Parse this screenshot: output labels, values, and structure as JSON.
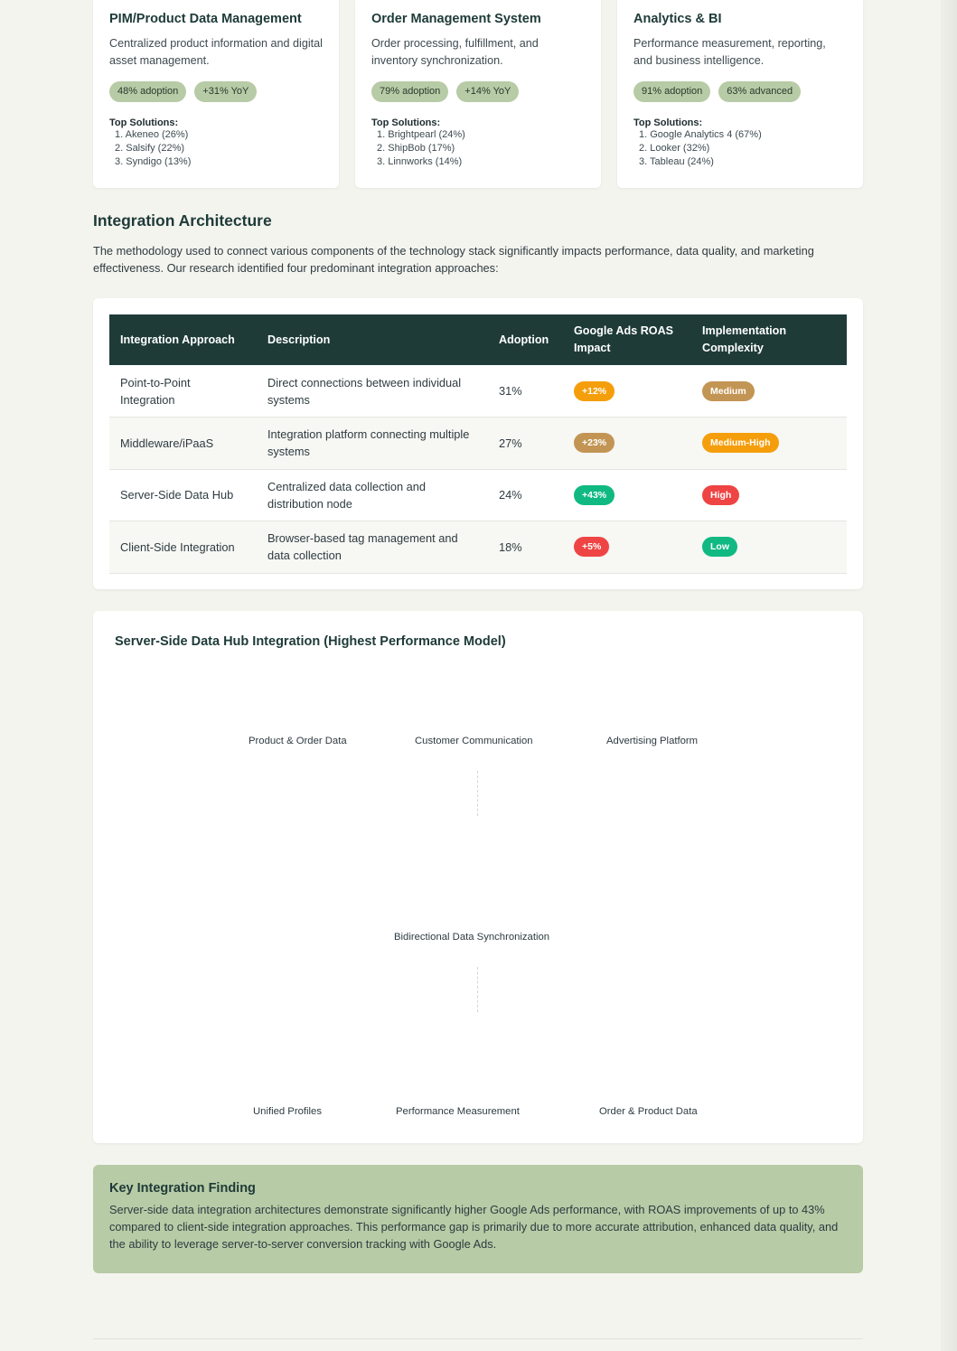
{
  "categories": [
    {
      "title": "PIM/Product Data Management",
      "description": "Centralized product information and digital asset management.",
      "pills": [
        "48% adoption",
        "+31% YoY"
      ],
      "solutions_title": "Top Solutions:",
      "solutions": [
        "1. Akeneo (26%)",
        "2. Salsify (22%)",
        "3. Syndigo (13%)"
      ]
    },
    {
      "title": "Order Management System",
      "description": "Order processing, fulfillment, and inventory synchronization.",
      "pills": [
        "79% adoption",
        "+14% YoY"
      ],
      "solutions_title": "Top Solutions:",
      "solutions": [
        "1. Brightpearl (24%)",
        "2. ShipBob (17%)",
        "3. Linnworks (14%)"
      ]
    },
    {
      "title": "Analytics & BI",
      "description": "Performance measurement, reporting, and business intelligence.",
      "pills": [
        "91% adoption",
        "63% advanced"
      ],
      "solutions_title": "Top Solutions:",
      "solutions": [
        "1. Google Analytics 4 (67%)",
        "2. Looker (32%)",
        "3. Tableau (24%)"
      ]
    }
  ],
  "integration": {
    "title": "Integration Architecture",
    "intro": "The methodology used to connect various components of the technology stack significantly impacts performance, data quality, and marketing effectiveness. Our research identified four predominant integration approaches:",
    "table": {
      "headers": [
        "Integration Approach",
        "Description",
        "Adoption",
        "Google Ads ROAS Impact",
        "Implementation Complexity"
      ],
      "rows": [
        {
          "approach": "Point-to-Point Integration",
          "description": "Direct connections between individual systems",
          "adoption": "31%",
          "roas": "+12%",
          "roas_color": "#f59e0b",
          "complexity": "Medium",
          "complexity_color": "#c39554"
        },
        {
          "approach": "Middleware/iPaaS",
          "description": "Integration platform connecting multiple systems",
          "adoption": "27%",
          "roas": "+23%",
          "roas_color": "#c39554",
          "complexity": "Medium-High",
          "complexity_color": "#f59e0b"
        },
        {
          "approach": "Server-Side Data Hub",
          "description": "Centralized data collection and distribution node",
          "adoption": "24%",
          "roas": "+43%",
          "roas_color": "#10b981",
          "complexity": "High",
          "complexity_color": "#ef4444"
        },
        {
          "approach": "Client-Side Integration",
          "description": "Browser-based tag management and data collection",
          "adoption": "18%",
          "roas": "+5%",
          "roas_color": "#ef4444",
          "complexity": "Low",
          "complexity_color": "#10b981"
        }
      ]
    }
  },
  "diagram": {
    "title": "Server-Side Data Hub Integration (Highest Performance Model)",
    "top_labels": [
      "Product & Order Data",
      "Customer Communication",
      "Advertising Platform"
    ],
    "middle_label": "Bidirectional Data Synchronization",
    "bottom_labels": [
      "Unified Profiles",
      "Performance Measurement",
      "Order & Product Data"
    ]
  },
  "finding": {
    "title": "Key Integration Finding",
    "text": "Server-side data integration architectures demonstrate significantly higher Google Ads performance, with ROAS improvements of up to 43% compared to client-side integration approaches. This performance gap is primarily due to more accurate attribution, enhanced data quality, and the ability to leverage server-to-server conversion tracking with Google Ads."
  }
}
